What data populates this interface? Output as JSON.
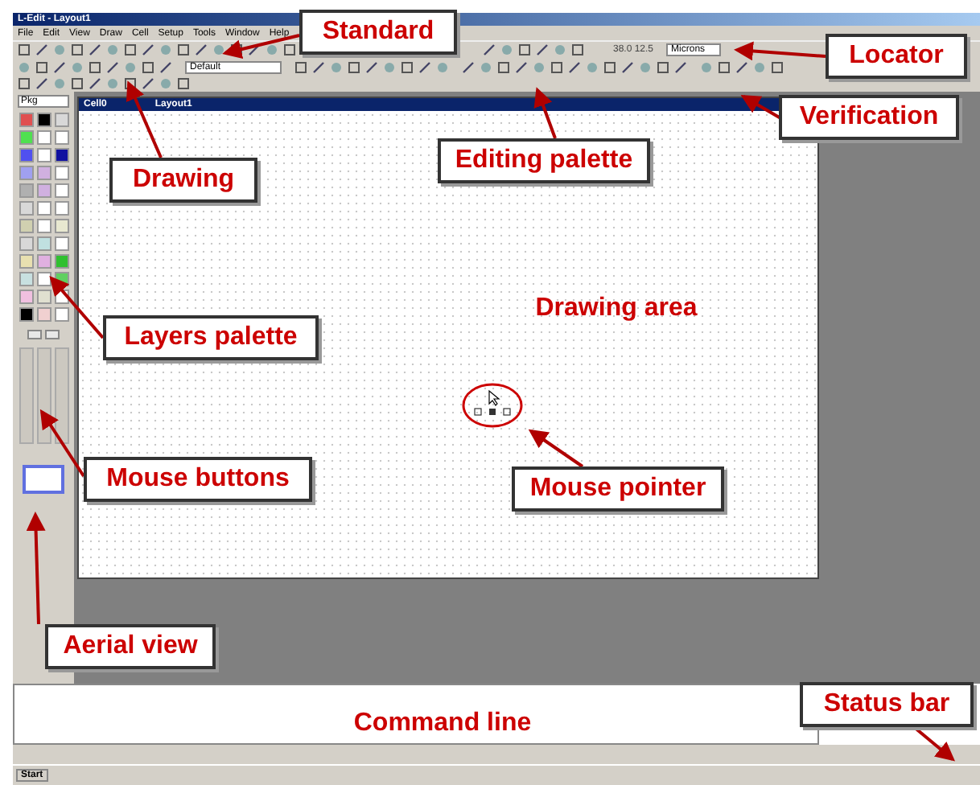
{
  "window": {
    "title": "L-Edit - Layout1"
  },
  "menu": [
    "File",
    "Edit",
    "View",
    "Draw",
    "Cell",
    "Setup",
    "Tools",
    "Window",
    "Help"
  ],
  "locator": {
    "reading": "38.0 12.5",
    "units": "Microns"
  },
  "drawing_toolbar": {
    "layer_select": "Default"
  },
  "layers": {
    "dropdown": "Pkg",
    "swatches": [
      {
        "color": "#e05050"
      },
      {
        "color": "#000000"
      },
      {
        "color": "#d8d8d8"
      },
      {
        "color": "#50e050"
      },
      {
        "color": "#ffffff"
      },
      {
        "color": "#ffffff"
      },
      {
        "color": "#5050f0"
      },
      {
        "color": "#ffffff"
      },
      {
        "color": "#1010a0"
      },
      {
        "color": "#a0a0f0"
      },
      {
        "color": "#d0b0e0"
      },
      {
        "color": "#ffffff"
      },
      {
        "color": "#b0b0b0"
      },
      {
        "color": "#d0b0e0"
      },
      {
        "color": "#ffffff"
      },
      {
        "color": "#d8d8d8"
      },
      {
        "color": "#ffffff"
      },
      {
        "color": "#ffffff"
      },
      {
        "color": "#d0d0b0"
      },
      {
        "color": "#ffffff"
      },
      {
        "color": "#e8e8d0"
      },
      {
        "color": "#d8d8d8"
      },
      {
        "color": "#c0e0e0"
      },
      {
        "color": "#ffffff"
      },
      {
        "color": "#e8e0b0"
      },
      {
        "color": "#e0b0e0"
      },
      {
        "color": "#30c030"
      },
      {
        "color": "#c8e0e0"
      },
      {
        "color": "#ffffff"
      },
      {
        "color": "#60d060"
      },
      {
        "color": "#f0c0e0"
      },
      {
        "color": "#e0e0d0"
      },
      {
        "color": "#ffffff"
      },
      {
        "color": "#000000"
      },
      {
        "color": "#f0d0d0"
      },
      {
        "color": "#ffffff"
      }
    ]
  },
  "document": {
    "title": "Cell0",
    "subtitle": "Layout1"
  },
  "taskbar": {
    "start": "Start"
  },
  "callouts": [
    {
      "kind": "boxed",
      "text": "Standard"
    },
    {
      "kind": "boxed",
      "text": "Locator"
    },
    {
      "kind": "boxed",
      "text": "Verification"
    },
    {
      "kind": "boxed",
      "text": "Editing palette"
    },
    {
      "kind": "boxed",
      "text": "Drawing"
    },
    {
      "kind": "plain",
      "text": "Drawing area"
    },
    {
      "kind": "boxed",
      "text": "Layers palette"
    },
    {
      "kind": "boxed",
      "text": "Mouse buttons"
    },
    {
      "kind": "boxed",
      "text": "Mouse pointer"
    },
    {
      "kind": "boxed",
      "text": "Aerial view"
    },
    {
      "kind": "plain",
      "text": "Command line"
    },
    {
      "kind": "boxed",
      "text": "Status bar"
    }
  ]
}
